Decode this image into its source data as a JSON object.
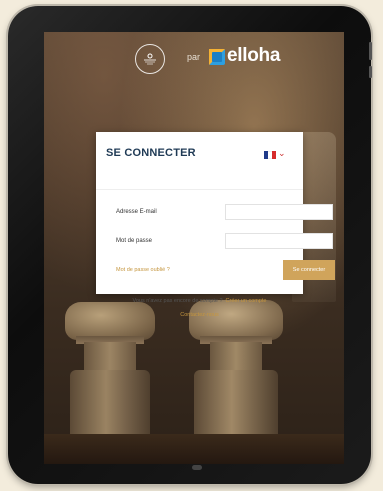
{
  "header": {
    "partner_logo_icon": "chardonnay-circle-logo-icon",
    "par_text": "par",
    "brand_name": "elloha",
    "brand_icon": "elloha-square-icon"
  },
  "login": {
    "title": "SE CONNECTER",
    "language": "FR",
    "flag_colors": [
      "#1f3a8a",
      "#ffffff",
      "#d62a2a"
    ],
    "email_label": "Adresse E-mail",
    "email_value": "",
    "password_label": "Mot de passe",
    "password_value": "",
    "forgot_link": "Mot de passe oublié ?",
    "submit_label": "Se connecter",
    "no_account_text": "Vous n'avez pas encore de compte ?",
    "create_account_link": "Créer un compte",
    "contact_link": "Contactez-nous"
  },
  "colors": {
    "accent": "#d0a45b",
    "title": "#1f3a55",
    "link": "#c5963f"
  }
}
